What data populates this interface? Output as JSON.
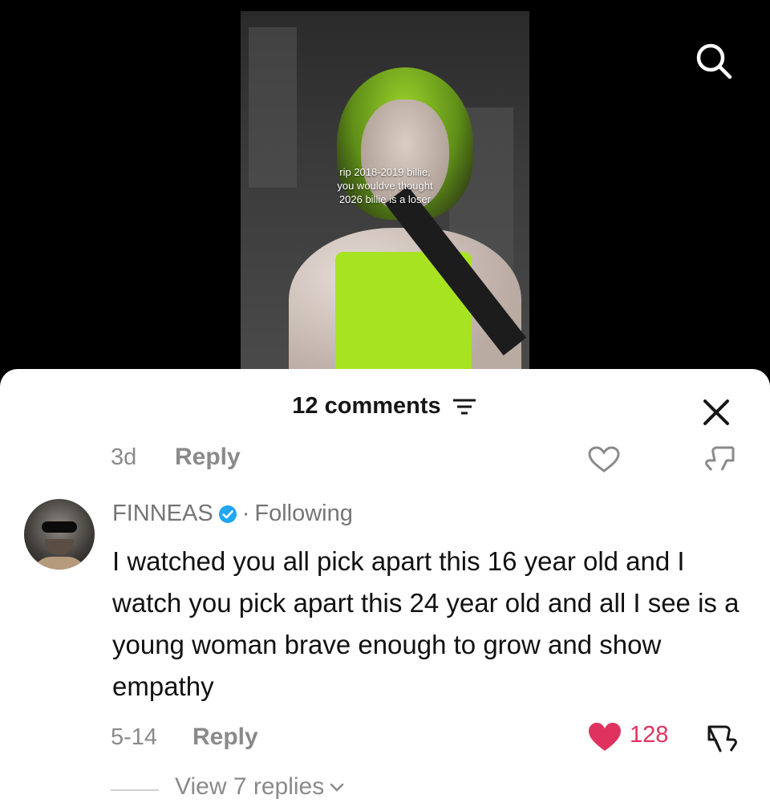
{
  "video": {
    "caption_lines": [
      "rip 2018-2019 billie,",
      "you wouldve thought",
      "2026 billie is a loser"
    ]
  },
  "icons": {
    "search": "search-icon",
    "close": "close-icon",
    "filter": "filter-icon",
    "like_outline": "heart-outline-icon",
    "dislike": "dislike-icon",
    "like_filled": "heart-filled-icon",
    "chevron": "chevron-down-icon"
  },
  "colors": {
    "like": "#e0325e",
    "verified": "#20a6f3",
    "sheet": "#ffffff"
  },
  "comments_header": {
    "title": "12 comments"
  },
  "prev_comment": {
    "time": "3d",
    "reply_label": "Reply"
  },
  "comment": {
    "username": "FINNEAS",
    "verified": true,
    "separator": "·",
    "relation": "Following",
    "text": "I watched you all pick apart this 16 year old and I watch you pick apart this 24 year old and all I see is a young woman brave enough to grow and show empathy",
    "date": "5-14",
    "reply_label": "Reply",
    "likes": "128",
    "view_replies": "View 7 replies"
  }
}
